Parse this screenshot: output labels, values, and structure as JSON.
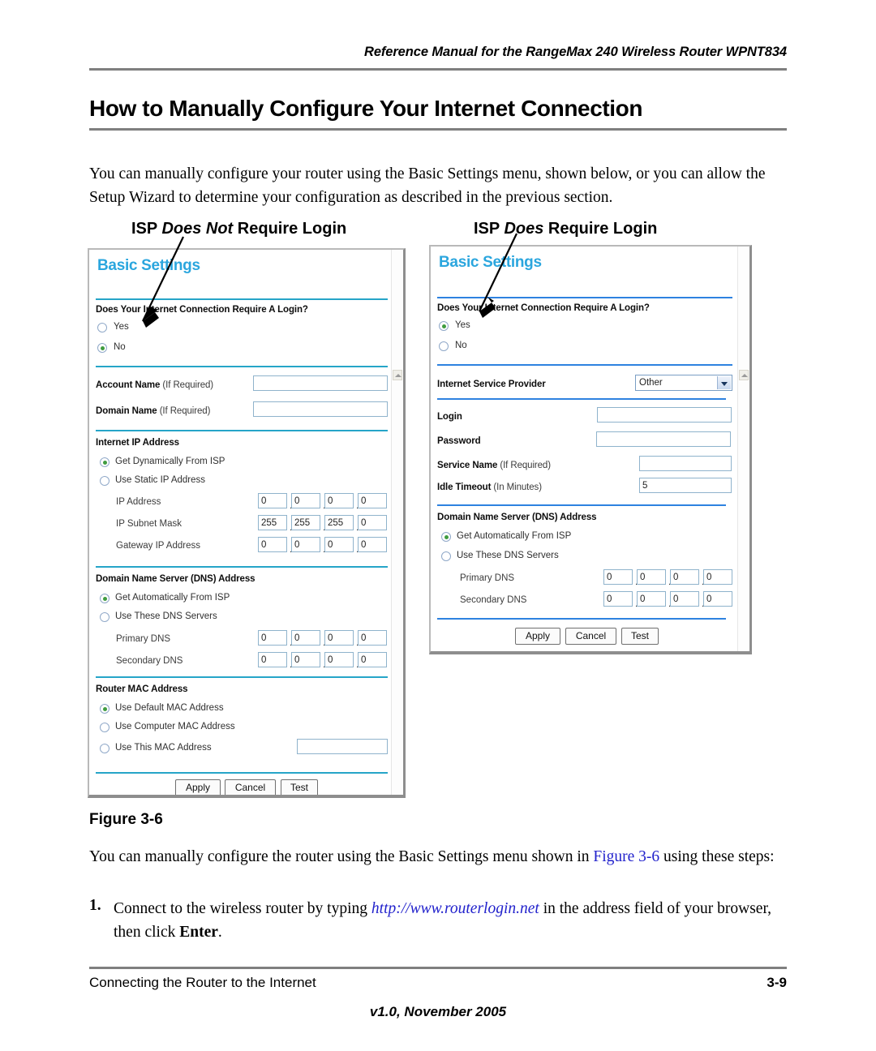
{
  "header": {
    "running_head": "Reference Manual for the RangeMax 240 Wireless Router WPNT834",
    "title": "How to Manually Configure Your Internet Connection"
  },
  "intro_paragraph": "You can manually configure your router using the Basic Settings menu, shown below, or you can allow the Setup Wizard to determine your configuration as described in the previous section.",
  "figure": {
    "caption": "Figure 3-6",
    "left_title_pre": "ISP ",
    "left_title_em": "Does Not",
    "left_title_post": " Require Login",
    "right_title_pre": "ISP ",
    "right_title_em": "Does",
    "right_title_post": " Require Login"
  },
  "colors": {
    "brand_cyan": "#2ba6de",
    "rule_teal": "#26a5c8",
    "rule_blue": "#2e82e0",
    "radio_selected": "#3f9c3f",
    "link_blue": "#2222cc",
    "field_border": "#8fb3cc"
  },
  "left_panel": {
    "brand": "Basic Settings",
    "login_question": "Does Your Internet Connection Require A Login?",
    "login_options": [
      {
        "label": "Yes",
        "selected": false
      },
      {
        "label": "No",
        "selected": true
      }
    ],
    "account_name_label_bold": "Account Name",
    "account_name_label_note": " (If Required)",
    "account_name_value": "",
    "domain_name_label_bold": "Domain Name",
    "domain_name_label_note": " (If Required)",
    "domain_name_value": "",
    "ip_section_heading": "Internet IP Address",
    "ip_options": [
      {
        "label": "Get Dynamically From ISP",
        "selected": true
      },
      {
        "label": "Use Static IP Address",
        "selected": false
      }
    ],
    "ip_rows": [
      {
        "label": "IP Address",
        "octets": [
          "0",
          "0",
          "0",
          "0"
        ]
      },
      {
        "label": "IP Subnet Mask",
        "octets": [
          "255",
          "255",
          "255",
          "0"
        ]
      },
      {
        "label": "Gateway IP Address",
        "octets": [
          "0",
          "0",
          "0",
          "0"
        ]
      }
    ],
    "dns_section_heading": "Domain Name Server (DNS) Address",
    "dns_options": [
      {
        "label": "Get Automatically From ISP",
        "selected": true
      },
      {
        "label": "Use These DNS Servers",
        "selected": false
      }
    ],
    "dns_rows": [
      {
        "label": "Primary DNS",
        "octets": [
          "0",
          "0",
          "0",
          "0"
        ]
      },
      {
        "label": "Secondary DNS",
        "octets": [
          "0",
          "0",
          "0",
          "0"
        ]
      }
    ],
    "mac_section_heading": "Router MAC Address",
    "mac_options": [
      {
        "label": "Use Default MAC Address",
        "selected": true
      },
      {
        "label": "Use Computer MAC Address",
        "selected": false
      },
      {
        "label": "Use This MAC Address",
        "selected": false
      }
    ],
    "mac_value": "",
    "buttons": [
      "Apply",
      "Cancel",
      "Test"
    ]
  },
  "right_panel": {
    "brand": "Basic Settings",
    "login_question": "Does Your Internet Connection Require A Login?",
    "login_options": [
      {
        "label": "Yes",
        "selected": true
      },
      {
        "label": "No",
        "selected": false
      }
    ],
    "isp_label": "Internet Service Provider",
    "isp_value": "Other",
    "login_label": "Login",
    "login_value": "",
    "password_label": "Password",
    "password_value": "",
    "service_name_label_bold": "Service Name",
    "service_name_label_note": " (If Required)",
    "service_name_value": "",
    "idle_timeout_label_bold": "Idle Timeout",
    "idle_timeout_label_note": " (In Minutes)",
    "idle_timeout_value": "5",
    "dns_section_heading": "Domain Name Server (DNS) Address",
    "dns_options": [
      {
        "label": "Get Automatically From ISP",
        "selected": true
      },
      {
        "label": "Use These DNS Servers",
        "selected": false
      }
    ],
    "dns_rows": [
      {
        "label": "Primary DNS",
        "octets": [
          "0",
          "0",
          "0",
          "0"
        ]
      },
      {
        "label": "Secondary DNS",
        "octets": [
          "0",
          "0",
          "0",
          "0"
        ]
      }
    ],
    "buttons": [
      "Apply",
      "Cancel",
      "Test"
    ]
  },
  "after_figure": {
    "para_pre": "You can manually configure the router using the Basic Settings menu shown in ",
    "para_link": "Figure 3-6",
    "para_post": " using these steps:",
    "step_number": "1.",
    "step_pre": "Connect to the wireless router by typing ",
    "step_url": "http://www.routerlogin.net",
    "step_mid": " in the address field of your browser, then click ",
    "step_bold": "Enter",
    "step_post": "."
  },
  "footer": {
    "left": "Connecting the Router to the Internet",
    "page_number": "3-9",
    "version": "v1.0, November 2005"
  }
}
